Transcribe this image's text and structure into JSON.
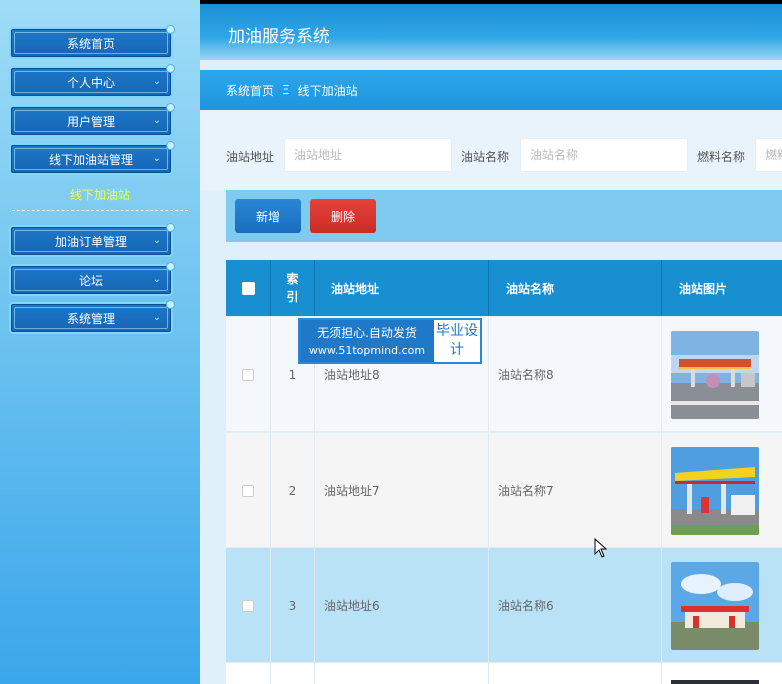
{
  "header": {
    "title": "加油服务系统"
  },
  "sidebar": {
    "items": [
      {
        "label": "系统首页"
      },
      {
        "label": "个人中心"
      },
      {
        "label": "用户管理"
      },
      {
        "label": "线下加油站管理"
      },
      {
        "label": "加油订单管理"
      },
      {
        "label": "论坛"
      },
      {
        "label": "系统管理"
      }
    ],
    "sub_item": "线下加油站"
  },
  "breadcrumb": {
    "home": "系统首页",
    "separator": "Ξ",
    "current": "线下加油站"
  },
  "search": {
    "address_label": "油站地址",
    "address_placeholder": "油站地址",
    "name_label": "油站名称",
    "name_placeholder": "油站名称",
    "fuel_label": "燃料名称",
    "fuel_placeholder": "燃料名称"
  },
  "actions": {
    "add_label": "新增",
    "delete_label": "删除"
  },
  "table": {
    "headers": {
      "index": "索引",
      "address": "油站地址",
      "name": "油站名称",
      "image": "油站图片"
    },
    "rows": [
      {
        "index": "1",
        "address": "油站地址8",
        "name": "油站名称8"
      },
      {
        "index": "2",
        "address": "油站地址7",
        "name": "油站名称7"
      },
      {
        "index": "3",
        "address": "油站地址6",
        "name": "油站名称6"
      }
    ]
  },
  "watermark": {
    "line1": "无须担心.自动发货",
    "line2": "www.51topmind.com",
    "right": "毕业设计"
  },
  "colors": {
    "sidebar_accent": "#1565b5",
    "header_blue": "#178fd1",
    "delete_red": "#d9362f",
    "sub_item_yellow": "#f6ff3a"
  }
}
